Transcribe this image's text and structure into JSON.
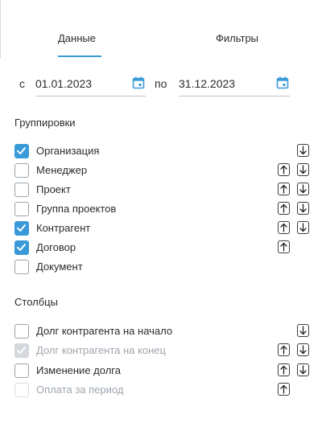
{
  "tabs": {
    "data": "Данные",
    "filters": "Фильтры"
  },
  "dates": {
    "from_prefix": "с",
    "from_value": "01.01.2023",
    "to_prefix": "по",
    "to_value": "31.12.2023",
    "icon": "calendar-icon"
  },
  "groupings": {
    "title": "Группировки",
    "items": [
      {
        "label": "Организация",
        "state": "checked",
        "up": false,
        "down": true
      },
      {
        "label": "Менеджер",
        "state": "unchecked",
        "up": true,
        "down": true
      },
      {
        "label": "Проект",
        "state": "unchecked",
        "up": true,
        "down": true
      },
      {
        "label": "Группа проектов",
        "state": "unchecked",
        "up": true,
        "down": true
      },
      {
        "label": "Контрагент",
        "state": "checked",
        "up": true,
        "down": true
      },
      {
        "label": "Договор",
        "state": "checked",
        "up": true,
        "down": false
      },
      {
        "label": "Документ",
        "state": "unchecked",
        "up": false,
        "down": false
      }
    ]
  },
  "columns": {
    "title": "Столбцы",
    "items": [
      {
        "label": "Долг контрагента на начало",
        "state": "unchecked",
        "up": false,
        "down": true
      },
      {
        "label": "Долг контрагента на конец",
        "state": "checked-disabled",
        "up": true,
        "down": true
      },
      {
        "label": "Изменение долга",
        "state": "unchecked",
        "up": true,
        "down": true
      },
      {
        "label": "Оплата за период",
        "state": "disabled",
        "up": true,
        "down": false
      }
    ]
  },
  "colors": {
    "accent": "#3a9ad9",
    "text": "#2b2b2b",
    "muted": "#9ea6ae"
  },
  "icons": {
    "up": "arrow-up-icon",
    "down": "arrow-down-icon",
    "check": "check-icon"
  }
}
